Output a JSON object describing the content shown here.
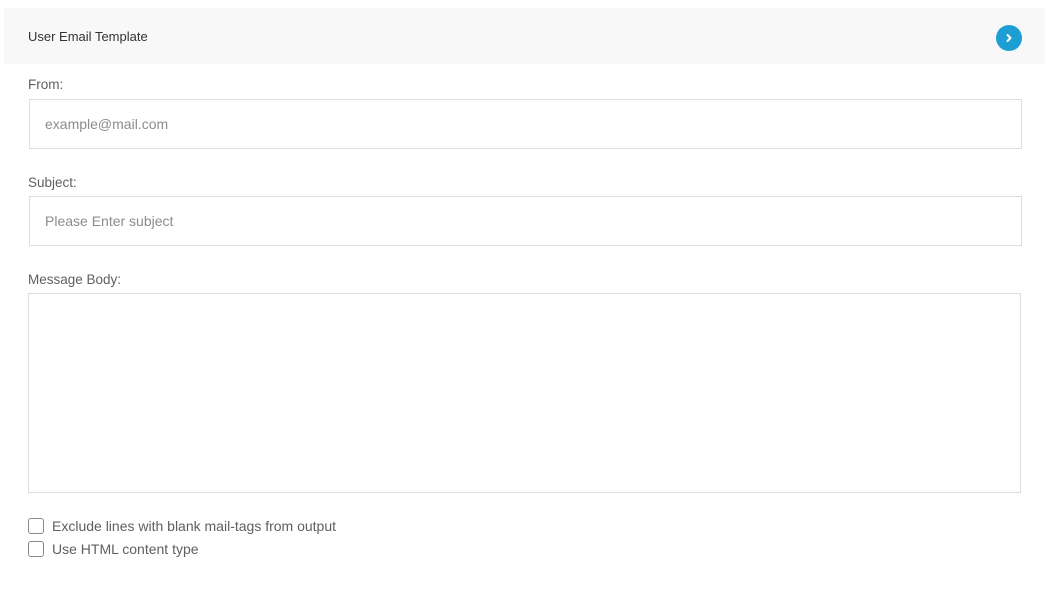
{
  "panel": {
    "title": "User Email Template",
    "toggle_icon": "chevron-right-icon",
    "accent_color": "#1e9fd4"
  },
  "form": {
    "from": {
      "label": "From:",
      "value": "",
      "placeholder": "example@mail.com"
    },
    "subject": {
      "label": "Subject:",
      "value": "",
      "placeholder": "Please Enter subject"
    },
    "message_body": {
      "label": "Message Body:",
      "value": ""
    },
    "options": [
      {
        "label": "Exclude lines with blank mail-tags from output",
        "checked": false
      },
      {
        "label": "Use HTML content type",
        "checked": false
      }
    ]
  }
}
